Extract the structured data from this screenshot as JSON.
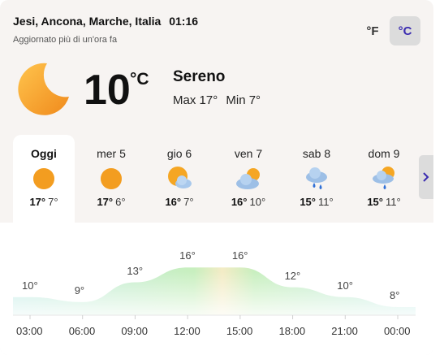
{
  "location": "Jesi, Ancona, Marche, Italia",
  "time": "01:16",
  "updated": "Aggiornato più di un'ora fa",
  "units": {
    "f": "°F",
    "c": "°C",
    "active": "c"
  },
  "current": {
    "icon": "moon-icon",
    "temp": "10",
    "unit": "°C",
    "condition": "Sereno",
    "max_label": "Max 17°",
    "min_label": "Min 7°"
  },
  "days": [
    {
      "name": "Oggi",
      "hi": "17°",
      "lo": "7°",
      "icon": "sunny-icon",
      "selected": true
    },
    {
      "name": "mer 5",
      "hi": "17°",
      "lo": "6°",
      "icon": "sunny-icon"
    },
    {
      "name": "gio 6",
      "hi": "16°",
      "lo": "7°",
      "icon": "partly-cloudy-icon"
    },
    {
      "name": "ven 7",
      "hi": "16°",
      "lo": "10°",
      "icon": "mostly-cloudy-icon"
    },
    {
      "name": "sab 8",
      "hi": "15°",
      "lo": "11°",
      "icon": "rain-icon"
    },
    {
      "name": "dom 9",
      "hi": "15°",
      "lo": "11°",
      "icon": "sun-rain-icon"
    }
  ],
  "next_icon": "chevron-right-icon",
  "chart_data": {
    "type": "area",
    "x": [
      "03:00",
      "06:00",
      "09:00",
      "12:00",
      "15:00",
      "18:00",
      "21:00",
      "00:00"
    ],
    "series": [
      {
        "values": [
          10,
          9,
          13,
          16,
          16,
          12,
          10,
          8
        ]
      }
    ],
    "temp_labels": [
      "10°",
      "9°",
      "13°",
      "16°",
      "16°",
      "12°",
      "10°",
      "8°"
    ],
    "ylim": [
      0,
      20
    ]
  }
}
